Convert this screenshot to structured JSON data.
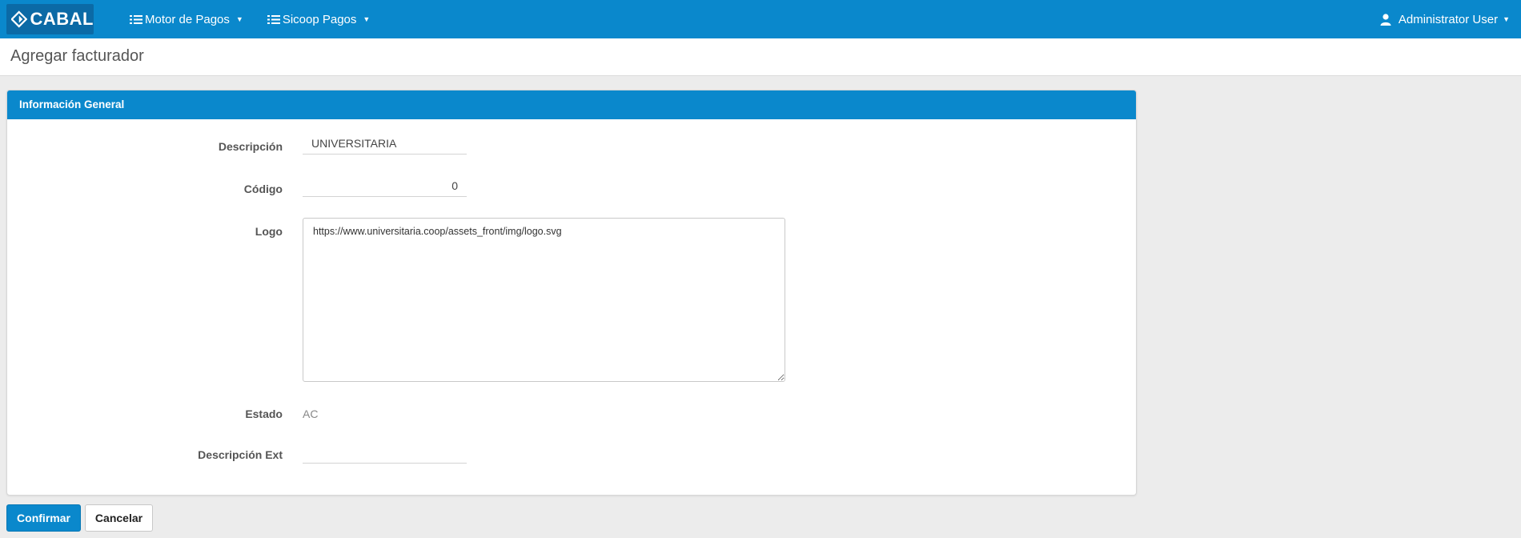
{
  "navbar": {
    "brand": "CABAL",
    "menus": [
      {
        "label": "Motor de Pagos"
      },
      {
        "label": "Sicoop Pagos"
      }
    ],
    "user": "Administrator User"
  },
  "page": {
    "title": "Agregar facturador"
  },
  "panel": {
    "heading": "Información General",
    "fields": {
      "descripcion": {
        "label": "Descripción",
        "value": "UNIVERSITARIA"
      },
      "codigo": {
        "label": "Código",
        "value": "0"
      },
      "logo": {
        "label": "Logo",
        "value": "https://www.universitaria.coop/assets_front/img/logo.svg"
      },
      "estado": {
        "label": "Estado",
        "value": "AC"
      },
      "descripcion_ext": {
        "label": "Descripción Ext",
        "value": ""
      }
    }
  },
  "actions": {
    "confirm": "Confirmar",
    "cancel": "Cancelar"
  },
  "colors": {
    "primary": "#0a88cc",
    "brand_bg": "#0b6aa6",
    "page_bg": "#ececec"
  }
}
